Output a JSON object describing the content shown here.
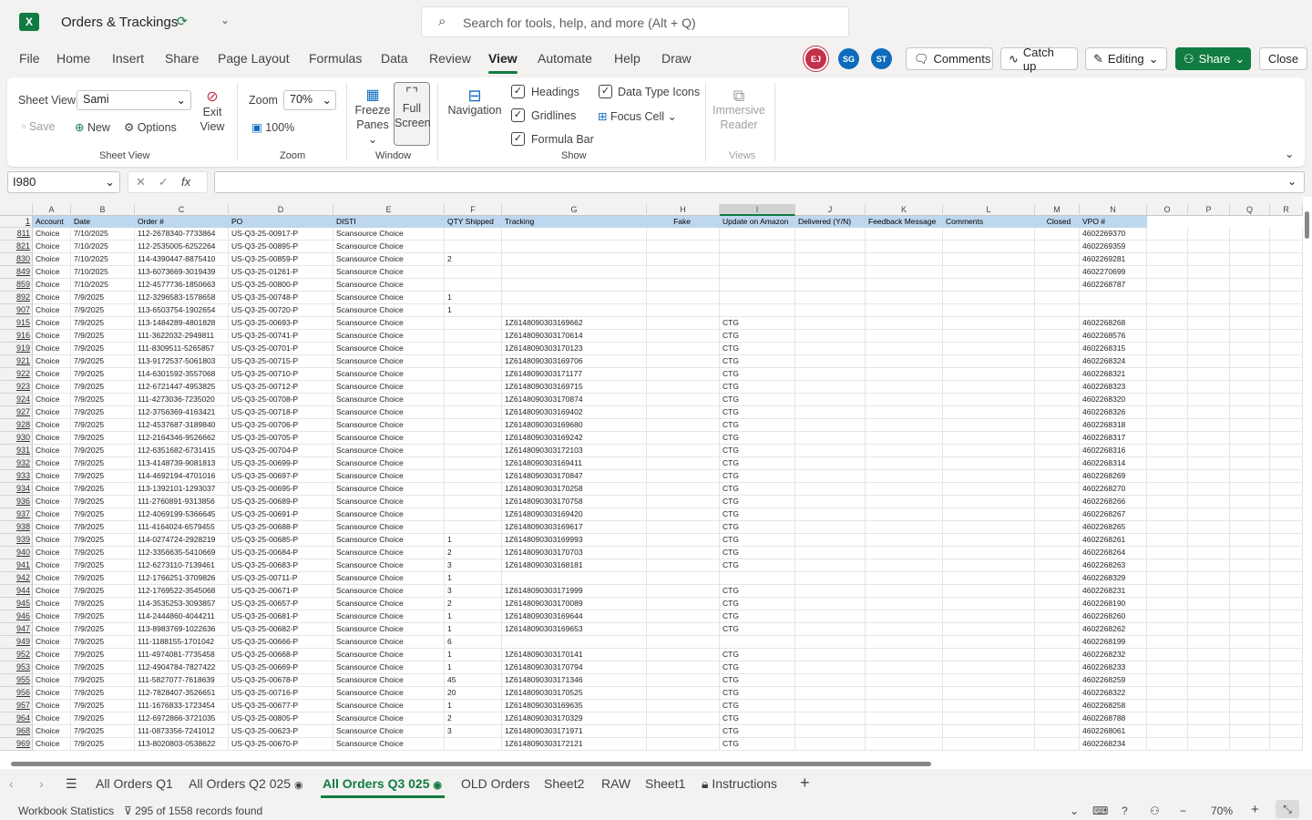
{
  "titlebar": {
    "app_icon": "X",
    "doc_title": "Orders & Trackings",
    "search_placeholder": "Search for tools, help, and more (Alt + Q)"
  },
  "menu": {
    "tabs": [
      "File",
      "Home",
      "Insert",
      "Share",
      "Page Layout",
      "Formulas",
      "Data",
      "Review",
      "View",
      "Automate",
      "Help",
      "Draw"
    ],
    "active": "View",
    "avatars": [
      {
        "initials": "EJ",
        "color": "#c4314b"
      },
      {
        "initials": "SG",
        "color": "#0f6cbd"
      },
      {
        "initials": "ST",
        "color": "#0f6cbd"
      }
    ],
    "comments": "Comments",
    "catch_up": "Catch up",
    "editing": "Editing",
    "share": "Share",
    "close": "Close"
  },
  "ribbon": {
    "sheet_view_label": "Sheet View",
    "sheet_view_value": "Sami",
    "save": "Save",
    "new": "New",
    "options": "Options",
    "exit_view_1": "Exit",
    "exit_view_2": "View",
    "group_sheet_view": "Sheet View",
    "zoom_label": "Zoom",
    "zoom_value": "70%",
    "zoom_100": "100%",
    "group_zoom": "Zoom",
    "freeze_1": "Freeze",
    "freeze_2": "Panes",
    "full_1": "Full",
    "full_2": "Screen",
    "group_window": "Window",
    "navigation": "Navigation",
    "headings": "Headings",
    "gridlines": "Gridlines",
    "formula_bar": "Formula Bar",
    "data_type_icons": "Data Type Icons",
    "focus_cell": "Focus Cell",
    "group_show": "Show",
    "immersive_1": "Immersive",
    "immersive_2": "Reader",
    "group_views": "Views"
  },
  "formula": {
    "namebox": "I980",
    "fx": "fx",
    "value": ""
  },
  "grid": {
    "columns": [
      "A",
      "B",
      "C",
      "D",
      "E",
      "F",
      "G",
      "H",
      "I",
      "J",
      "K",
      "L",
      "M",
      "N",
      "O",
      "P",
      "Q",
      "R"
    ],
    "selected_column": "I",
    "header_row_num": "1",
    "headers": [
      "Account",
      "Date",
      "Order #",
      "PO",
      "DISTI",
      "QTY Shipped",
      "Tracking",
      "Fake",
      "Update on Amazon",
      "Delivered (Y/N)",
      "Feedback Message",
      "Comments",
      "Closed",
      "VPO #"
    ],
    "rows": [
      [
        "811",
        "Choice",
        "7/10/2025",
        "112-2678340-7733864",
        "US-Q3-25-00917-P",
        "Scansource Choice",
        "",
        "",
        "",
        "",
        "4602269370"
      ],
      [
        "821",
        "Choice",
        "7/10/2025",
        "112-2535005-6252264",
        "US-Q3-25-00895-P",
        "Scansource Choice",
        "",
        "",
        "",
        "",
        "4602269359"
      ],
      [
        "830",
        "Choice",
        "7/10/2025",
        "114-4390447-8875410",
        "US-Q3-25-00859-P",
        "Scansource Choice",
        "2",
        "",
        "",
        "",
        "4602269281"
      ],
      [
        "849",
        "Choice",
        "7/10/2025",
        "113-6073669-3019439",
        "US-Q3-25-01261-P",
        "Scansource Choice",
        "",
        "",
        "",
        "",
        "4602270699"
      ],
      [
        "859",
        "Choice",
        "7/10/2025",
        "112-4577736-1850663",
        "US-Q3-25-00800-P",
        "Scansource Choice",
        "",
        "",
        "",
        "",
        "4602268787"
      ],
      [
        "892",
        "Choice",
        "7/9/2025",
        "112-3296583-1578658",
        "US-Q3-25-00748-P",
        "Scansource Choice",
        "1",
        "",
        "",
        "",
        ""
      ],
      [
        "907",
        "Choice",
        "7/9/2025",
        "113-6503754-1902654",
        "US-Q3-25-00720-P",
        "Scansource Choice",
        "1",
        "",
        "",
        "",
        ""
      ],
      [
        "915",
        "Choice",
        "7/9/2025",
        "113-1484289-4801828",
        "US-Q3-25-00693-P",
        "Scansource Choice",
        "",
        "1Z6148090303169662",
        "",
        "CTG",
        "4602268268"
      ],
      [
        "916",
        "Choice",
        "7/9/2025",
        "111-3622032-2949811",
        "US-Q3-25-00741-P",
        "Scansource Choice",
        "",
        "1Z6148090303170614",
        "",
        "CTG",
        "4602268576"
      ],
      [
        "919",
        "Choice",
        "7/9/2025",
        "111-8309511-5265857",
        "US-Q3-25-00701-P",
        "Scansource Choice",
        "",
        "1Z6148090303170123",
        "",
        "CTG",
        "4602268315"
      ],
      [
        "921",
        "Choice",
        "7/9/2025",
        "113-9172537-5061803",
        "US-Q3-25-00715-P",
        "Scansource Choice",
        "",
        "1Z6148090303169706",
        "",
        "CTG",
        "4602268324"
      ],
      [
        "922",
        "Choice",
        "7/9/2025",
        "114-6301592-3557068",
        "US-Q3-25-00710-P",
        "Scansource Choice",
        "",
        "1Z6148090303171177",
        "",
        "CTG",
        "4602268321"
      ],
      [
        "923",
        "Choice",
        "7/9/2025",
        "112-6721447-4953825",
        "US-Q3-25-00712-P",
        "Scansource Choice",
        "",
        "1Z6148090303169715",
        "",
        "CTG",
        "4602268323"
      ],
      [
        "924",
        "Choice",
        "7/9/2025",
        "111-4273036-7235020",
        "US-Q3-25-00708-P",
        "Scansource Choice",
        "",
        "1Z6148090303170874",
        "",
        "CTG",
        "4602268320"
      ],
      [
        "927",
        "Choice",
        "7/9/2025",
        "112-3756369-4163421",
        "US-Q3-25-00718-P",
        "Scansource Choice",
        "",
        "1Z6148090303169402",
        "",
        "CTG",
        "4602268326"
      ],
      [
        "928",
        "Choice",
        "7/9/2025",
        "112-4537687-3189840",
        "US-Q3-25-00706-P",
        "Scansource Choice",
        "",
        "1Z6148090303169680",
        "",
        "CTG",
        "4602268318"
      ],
      [
        "930",
        "Choice",
        "7/9/2025",
        "112-2164346-9526662",
        "US-Q3-25-00705-P",
        "Scansource Choice",
        "",
        "1Z6148090303169242",
        "",
        "CTG",
        "4602268317"
      ],
      [
        "931",
        "Choice",
        "7/9/2025",
        "112-6351682-6731415",
        "US-Q3-25-00704-P",
        "Scansource Choice",
        "",
        "1Z6148090303172103",
        "",
        "CTG",
        "4602268316"
      ],
      [
        "932",
        "Choice",
        "7/9/2025",
        "113-4148739-9081813",
        "US-Q3-25-00699-P",
        "Scansource Choice",
        "",
        "1Z6148090303169411",
        "",
        "CTG",
        "4602268314"
      ],
      [
        "933",
        "Choice",
        "7/9/2025",
        "114-4692194-4701016",
        "US-Q3-25-00697-P",
        "Scansource Choice",
        "",
        "1Z6148090303170847",
        "",
        "CTG",
        "4602268269"
      ],
      [
        "934",
        "Choice",
        "7/9/2025",
        "113-1392101-1293037",
        "US-Q3-25-00695-P",
        "Scansource Choice",
        "",
        "1Z6148090303170258",
        "",
        "CTG",
        "4602268270"
      ],
      [
        "936",
        "Choice",
        "7/9/2025",
        "111-2760891-9313856",
        "US-Q3-25-00689-P",
        "Scansource Choice",
        "",
        "1Z6148090303170758",
        "",
        "CTG",
        "4602268266"
      ],
      [
        "937",
        "Choice",
        "7/9/2025",
        "112-4069199-5366645",
        "US-Q3-25-00691-P",
        "Scansource Choice",
        "",
        "1Z6148090303169420",
        "",
        "CTG",
        "4602268267"
      ],
      [
        "938",
        "Choice",
        "7/9/2025",
        "111-4164024-6579455",
        "US-Q3-25-00688-P",
        "Scansource Choice",
        "",
        "1Z6148090303169617",
        "",
        "CTG",
        "4602268265"
      ],
      [
        "939",
        "Choice",
        "7/9/2025",
        "114-0274724-2928219",
        "US-Q3-25-00685-P",
        "Scansource Choice",
        "1",
        "1Z6148090303169993",
        "",
        "CTG",
        "4602268261"
      ],
      [
        "940",
        "Choice",
        "7/9/2025",
        "112-3356635-5410669",
        "US-Q3-25-00684-P",
        "Scansource Choice",
        "2",
        "1Z6148090303170703",
        "",
        "CTG",
        "4602268264"
      ],
      [
        "941",
        "Choice",
        "7/9/2025",
        "112-6273110-7139461",
        "US-Q3-25-00683-P",
        "Scansource Choice",
        "3",
        "1Z6148090303168181",
        "",
        "CTG",
        "4602268263"
      ],
      [
        "942",
        "Choice",
        "7/9/2025",
        "112-1766251-3709826",
        "US-Q3-25-00711-P",
        "Scansource Choice",
        "1",
        "",
        "",
        "",
        "4602268329"
      ],
      [
        "944",
        "Choice",
        "7/9/2025",
        "112-1769522-3545068",
        "US-Q3-25-00671-P",
        "Scansource Choice",
        "3",
        "1Z6148090303171999",
        "",
        "CTG",
        "4602268231"
      ],
      [
        "945",
        "Choice",
        "7/9/2025",
        "114-3535253-3093857",
        "US-Q3-25-00657-P",
        "Scansource Choice",
        "2",
        "1Z6148090303170089",
        "",
        "CTG",
        "4602268190"
      ],
      [
        "946",
        "Choice",
        "7/9/2025",
        "114-2444860-4044211",
        "US-Q3-25-00681-P",
        "Scansource Choice",
        "1",
        "1Z6148090303169644",
        "",
        "CTG",
        "4602268260"
      ],
      [
        "947",
        "Choice",
        "7/9/2025",
        "113-8983769-1022636",
        "US-Q3-25-00682-P",
        "Scansource Choice",
        "1",
        "1Z6148090303169653",
        "",
        "CTG",
        "4602268262"
      ],
      [
        "949",
        "Choice",
        "7/9/2025",
        "111-1188155-1701042",
        "US-Q3-25-00666-P",
        "Scansource Choice",
        "6",
        "",
        "",
        "",
        "4602268199"
      ],
      [
        "952",
        "Choice",
        "7/9/2025",
        "111-4974081-7735458",
        "US-Q3-25-00668-P",
        "Scansource Choice",
        "1",
        "1Z6148090303170141",
        "",
        "CTG",
        "4602268232"
      ],
      [
        "953",
        "Choice",
        "7/9/2025",
        "112-4904784-7827422",
        "US-Q3-25-00669-P",
        "Scansource Choice",
        "1",
        "1Z6148090303170794",
        "",
        "CTG",
        "4602268233"
      ],
      [
        "955",
        "Choice",
        "7/9/2025",
        "111-5827077-7618639",
        "US-Q3-25-00678-P",
        "Scansource Choice",
        "45",
        "1Z6148090303171346",
        "",
        "CTG",
        "4602268259"
      ],
      [
        "956",
        "Choice",
        "7/9/2025",
        "112-7828407-3526651",
        "US-Q3-25-00716-P",
        "Scansource Choice",
        "20",
        "1Z6148090303170525",
        "",
        "CTG",
        "4602268322"
      ],
      [
        "957",
        "Choice",
        "7/9/2025",
        "111-1676833-1723454",
        "US-Q3-25-00677-P",
        "Scansource Choice",
        "1",
        "1Z6148090303169635",
        "",
        "CTG",
        "4602268258"
      ],
      [
        "964",
        "Choice",
        "7/9/2025",
        "112-6972866-3721035",
        "US-Q3-25-00805-P",
        "Scansource Choice",
        "2",
        "1Z6148090303170329",
        "",
        "CTG",
        "4602268788"
      ],
      [
        "968",
        "Choice",
        "7/9/2025",
        "111-0873356-7241012",
        "US-Q3-25-00623-P",
        "Scansource Choice",
        "3",
        "1Z6148090303171971",
        "",
        "CTG",
        "4602268061"
      ],
      [
        "969",
        "Choice",
        "7/9/2025",
        "113-8020803-0538622",
        "US-Q3-25-00670-P",
        "Scansource Choice",
        "",
        "1Z6148090303172121",
        "",
        "CTG",
        "4602268234"
      ]
    ]
  },
  "sheets": {
    "tabs": [
      "All Orders Q1",
      "All Orders Q2 025",
      "All Orders Q3 025",
      "OLD Orders",
      "Sheet2",
      "RAW",
      "Sheet1",
      "Instructions"
    ],
    "active": "All Orders Q3 025"
  },
  "status": {
    "workbook_stats": "Workbook Statistics",
    "records": "295 of 1558 records found",
    "zoom": "70%"
  }
}
